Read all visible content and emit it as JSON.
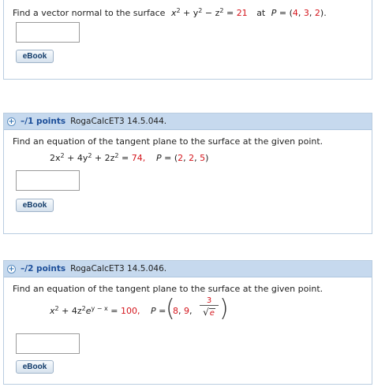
{
  "q1": {
    "prompt": "Find a vector normal to the surface",
    "eq_pre": "x",
    "eq_sq1": "2",
    "eq_mid1": " + y",
    "eq_sq2": "2",
    "eq_mid2": " − z",
    "eq_sq3": "2",
    "eq_eq": " = ",
    "eq_val": "21",
    "at": "at",
    "point_label": "P",
    "point_eq": " = (",
    "p1": "4",
    "c1": ", ",
    "p2": "3",
    "c2": ", ",
    "p3": "2",
    "close": ").",
    "ebook_label": "eBook"
  },
  "q2": {
    "points": "–/1 points",
    "code": "RogaCalcET3 14.5.044.",
    "prompt": "Find an equation of the tangent plane to the surface at the given point.",
    "eq_a": "2x",
    "eq_a_sq": "2",
    "eq_b": " + 4y",
    "eq_b_sq": "2",
    "eq_c": " + 2z",
    "eq_c_sq": "2",
    "eq_eq": " = ",
    "eq_val": "74,",
    "point_label": "P",
    "point_eq": " = (",
    "p1": "2",
    "c1": ", ",
    "p2": "2",
    "c2": ", ",
    "p3": "5",
    "close": ")",
    "ebook_label": "eBook"
  },
  "q3": {
    "points": "–/2 points",
    "code": "RogaCalcET3 14.5.046.",
    "prompt": "Find an equation of the tangent plane to the surface at the given point.",
    "eq_a": "x",
    "eq_a_sq": "2",
    "eq_b": " + 4z",
    "eq_b_sq": "2",
    "eq_b2": "e",
    "eq_exp": "y − x",
    "eq_eq": " = ",
    "eq_val": "100,",
    "point_label": "P",
    "point_eq": " = ",
    "p1": "8",
    "c1": ", ",
    "p2": "9",
    "c2": ", ",
    "frac_num": "3",
    "frac_sqrt": "√",
    "frac_den": "e",
    "ebook_label": "eBook"
  },
  "colors": {
    "header_bg": "#c6d9ee",
    "value_red": "#d4141b",
    "points_blue": "#1d4f9a"
  }
}
